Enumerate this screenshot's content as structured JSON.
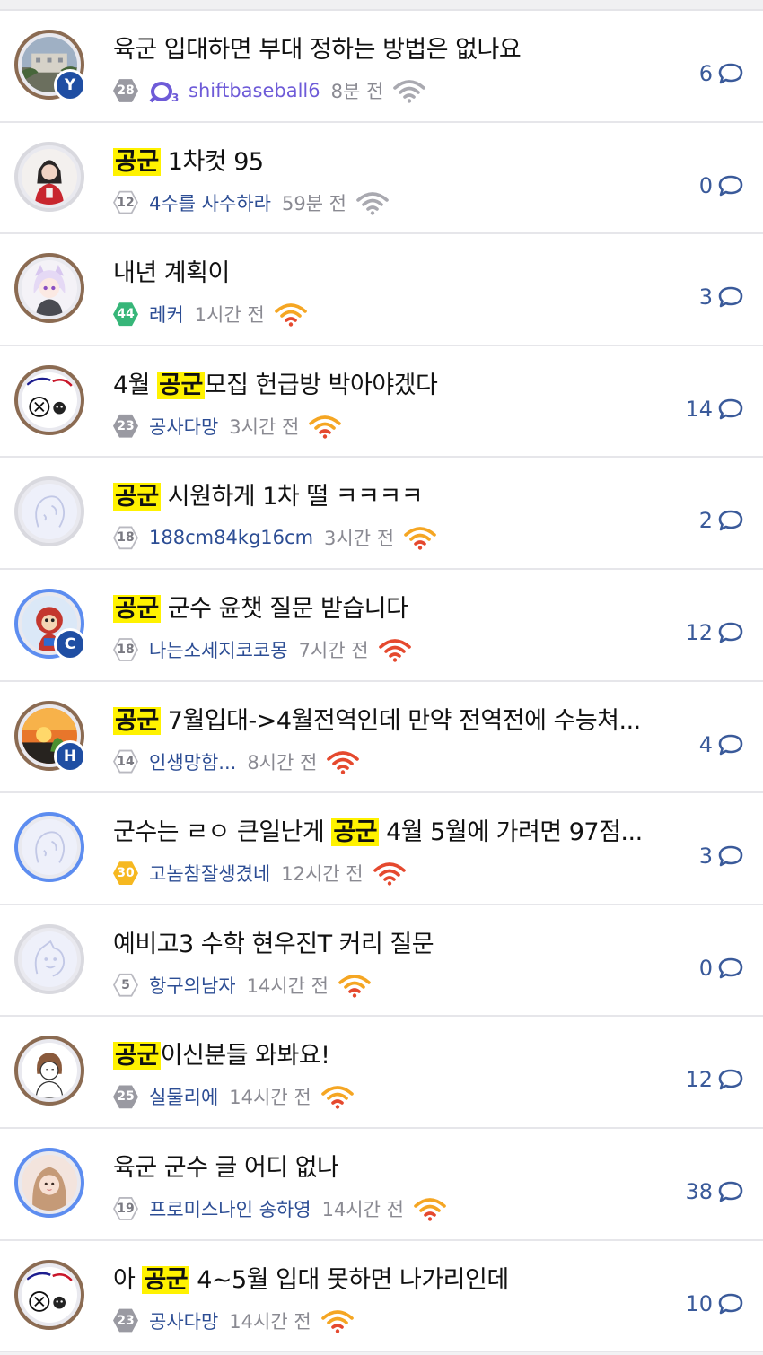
{
  "colors": {
    "highlight": "#fff200",
    "author": "#2c4d94",
    "muted": "#8a8a92",
    "signal_gray": "#a9a9b0",
    "signal_warm": "#f5a623",
    "signal_hot": "#e5492e"
  },
  "posts": [
    {
      "avatar": "photo",
      "ring": "brown",
      "badge": "Y",
      "title": [
        {
          "t": "육군 입대하면 부대 정하는 방법은 없나요",
          "hl": false
        }
      ],
      "level": "28",
      "level_style": "gray",
      "mark": "O3-icon",
      "author": "shiftbaseball6",
      "author_color": "purple",
      "time": "8분 전",
      "signal": "gray",
      "comments": "6"
    },
    {
      "avatar": "person",
      "ring": "gray",
      "badge": "",
      "title": [
        {
          "t": "공군",
          "hl": true
        },
        {
          "t": " 1차컷 95",
          "hl": false
        }
      ],
      "level": "12",
      "level_style": "outline",
      "mark": "",
      "author": "4수를 사수하라",
      "author_color": "blue",
      "time": "59분 전",
      "signal": "gray",
      "comments": "0"
    },
    {
      "avatar": "anime",
      "ring": "brown",
      "badge": "",
      "title": [
        {
          "t": "내년 계획이",
          "hl": false
        }
      ],
      "level": "44",
      "level_style": "green",
      "mark": "",
      "author": "레커",
      "author_color": "blue",
      "time": "1시간 전",
      "signal": "warm",
      "comments": "3"
    },
    {
      "avatar": "doodle",
      "ring": "brown",
      "badge": "",
      "title": [
        {
          "t": "4월 ",
          "hl": false
        },
        {
          "t": "공군",
          "hl": true
        },
        {
          "t": "모집 헌급방 박아야겠다",
          "hl": false
        }
      ],
      "level": "23",
      "level_style": "gray",
      "mark": "",
      "author": "공사다망",
      "author_color": "blue",
      "time": "3시간 전",
      "signal": "warm",
      "comments": "14"
    },
    {
      "avatar": "default",
      "ring": "gray",
      "badge": "",
      "title": [
        {
          "t": "공군",
          "hl": true
        },
        {
          "t": " 시원하게 1차 떨 ㅋㅋㅋㅋ",
          "hl": false
        }
      ],
      "level": "18",
      "level_style": "outline",
      "mark": "",
      "author": "188cm84kg16cm",
      "author_color": "blue",
      "time": "3시간 전",
      "signal": "warm",
      "comments": "2"
    },
    {
      "avatar": "mascot",
      "ring": "blue",
      "badge": "C",
      "title": [
        {
          "t": "공군",
          "hl": true
        },
        {
          "t": " 군수 윤챗 질문 받습니다",
          "hl": false
        }
      ],
      "level": "18",
      "level_style": "outline",
      "mark": "",
      "author": "나는소세지코코몽",
      "author_color": "blue",
      "time": "7시간 전",
      "signal": "hot",
      "comments": "12"
    },
    {
      "avatar": "sunset",
      "ring": "brown",
      "badge": "H",
      "title": [
        {
          "t": "공군",
          "hl": true
        },
        {
          "t": " 7월입대->4월전역인데 만약 전역전에 수능쳐...",
          "hl": false
        }
      ],
      "level": "14",
      "level_style": "outline",
      "mark": "",
      "author": "인생망함...",
      "author_color": "blue",
      "time": "8시간 전",
      "signal": "hot",
      "comments": "4"
    },
    {
      "avatar": "default",
      "ring": "blue",
      "badge": "",
      "title": [
        {
          "t": "군수는 ㄹㅇ 큰일난게 ",
          "hl": false
        },
        {
          "t": "공군",
          "hl": true
        },
        {
          "t": " 4월 5월에 가려면 97점...",
          "hl": false
        }
      ],
      "level": "30",
      "level_style": "gold",
      "mark": "",
      "author": "고놈참잘생겼네",
      "author_color": "blue",
      "time": "12시간 전",
      "signal": "hot",
      "comments": "3"
    },
    {
      "avatar": "default2",
      "ring": "gray",
      "badge": "",
      "title": [
        {
          "t": "예비고3 수학 현우진T 커리 질문",
          "hl": false
        }
      ],
      "level": "5",
      "level_style": "outline",
      "mark": "",
      "author": "항구의남자",
      "author_color": "blue",
      "time": "14시간 전",
      "signal": "warm",
      "comments": "0"
    },
    {
      "avatar": "sketch",
      "ring": "brown",
      "badge": "",
      "title": [
        {
          "t": "공군",
          "hl": true
        },
        {
          "t": "이신분들 와봐요!",
          "hl": false
        }
      ],
      "level": "25",
      "level_style": "gray",
      "mark": "",
      "author": "실물리에",
      "author_color": "blue",
      "time": "14시간 전",
      "signal": "warm",
      "comments": "12"
    },
    {
      "avatar": "girl",
      "ring": "blue",
      "badge": "",
      "title": [
        {
          "t": "육군 군수 글 어디 없나",
          "hl": false
        }
      ],
      "level": "19",
      "level_style": "outline",
      "mark": "",
      "author": "프로미스나인 송하영",
      "author_color": "blue",
      "time": "14시간 전",
      "signal": "warm",
      "comments": "38"
    },
    {
      "avatar": "doodle",
      "ring": "brown",
      "badge": "",
      "title": [
        {
          "t": "아 ",
          "hl": false
        },
        {
          "t": "공군",
          "hl": true
        },
        {
          "t": " 4~5월 입대 못하면 나가리인데",
          "hl": false
        }
      ],
      "level": "23",
      "level_style": "gray",
      "mark": "",
      "author": "공사다망",
      "author_color": "blue",
      "time": "14시간 전",
      "signal": "warm",
      "comments": "10"
    }
  ]
}
